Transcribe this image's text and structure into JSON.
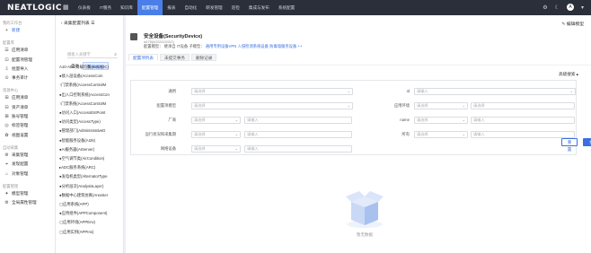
{
  "topbar": {
    "logo": "NEATLOGIC",
    "nav": [
      "仪表板",
      "IT服务",
      "知识库",
      "配置管理",
      "报表",
      "自动化",
      "研发管理",
      "巡检",
      "集成与发布",
      "系统配置"
    ],
    "active": "配置管理"
  },
  "sidebar": {
    "new_label": "新建",
    "groups": [
      {
        "title": "我的工作台",
        "items": [
          {
            "icon": "+",
            "label": "新建",
            "new": true
          }
        ]
      },
      {
        "title": "配置库",
        "items": [
          {
            "icon": "☰",
            "label": "应用清单"
          },
          {
            "icon": "⊡",
            "label": "配置项管理"
          },
          {
            "icon": "⇩",
            "label": "批量导入"
          },
          {
            "icon": "⊙",
            "label": "事务审计"
          }
        ]
      },
      {
        "title": "资源中心",
        "items": [
          {
            "icon": "⊞",
            "label": "应用清单"
          },
          {
            "icon": "⊟",
            "label": "资产清单"
          },
          {
            "icon": "⊠",
            "label": "账号管理"
          },
          {
            "icon": "◎",
            "label": "标签管理"
          },
          {
            "icon": "✿",
            "label": "视图设置"
          }
        ]
      },
      {
        "title": "自动采集",
        "items": [
          {
            "icon": "⚙",
            "label": "采集管理"
          },
          {
            "icon": "⌖",
            "label": "发现配置"
          },
          {
            "icon": "⌂",
            "label": "对象管理"
          }
        ]
      },
      {
        "title": "配置管理",
        "items": [
          {
            "icon": "✦",
            "label": "模型管理"
          },
          {
            "icon": "⚙",
            "label": "全局属性管理"
          }
        ]
      }
    ]
  },
  "tree": {
    "breadcrumb": "采集配置列表",
    "search_placeholder": "模板入关键字",
    "tabs": [
      "自动",
      "目录视图"
    ],
    "active_tab": "目录视图",
    "nodes": [
      "A10-ADC负载均衡(A10ADC)",
      "●接入层设备(AccessCom",
      "↑门禁系统(AccessControlM",
      "●出入口控制系统(AccessCon",
      "↑门禁系统(AccessControlM",
      "●访问入口(AccessEntPoint",
      "●访问类型(AccessType)",
      "●管理部门(AdministrativeD",
      "●智能服务设备(AI26)",
      "●AI服务器(AIServer)",
      "●空气调节类(AirCondition)",
      "▸ADC服务系统(ARC)",
      "●发电机类型(AlternatorType",
      "●分析层次(AnalysisLayer)",
      "●数据中心建筑仿真(AreaSer",
      "▢应用系统(APP)",
      "●应用组件(APPComponent)",
      "▢应用环境(APPEnv)",
      "▢应用实例(APPIns)"
    ]
  },
  "header": {
    "title": "安全设备(SecurityDevice)",
    "id": "#475(6/2/2/2/2/2/2)",
    "meta_prefix": "配置模型：",
    "meta_mid": "继承自 IT设备",
    "meta_child": "子模型：",
    "meta_links": "通用专用设备VPN 入侵检测系统设备 防毒墙服务设备 ++",
    "edit": "编辑模型",
    "tabs": [
      "配置项列表",
      "未提交事务",
      "删除记录"
    ],
    "active_tab": "配置项列表"
  },
  "form": {
    "adv_search": "高级搜索 ▴",
    "fields": [
      {
        "label": "通用",
        "ph": "请选择"
      },
      {
        "label": "id",
        "ph": "请输入"
      },
      {
        "label": "配置项模型",
        "ph": "请选择"
      },
      {
        "label": "应用环境",
        "ph": "请选择",
        "ph2": "请选择"
      },
      {
        "label": "厂商",
        "ph": "请选择",
        "ph2": "请输入"
      },
      {
        "label": "name",
        "ph": "请选择",
        "ph2": "请输入"
      },
      {
        "label": "运行状况和采集期",
        "ph": "请选择",
        "ph2": "请输入"
      },
      {
        "label": "所有",
        "ph": "请选择",
        "ph2": "请输入"
      },
      {
        "label": "网络设备",
        "ph": "请选择",
        "ph2": "请输入"
      }
    ],
    "reset": "重置",
    "search": "搜索"
  },
  "empty": {
    "text": "暂无数据"
  },
  "colors": {
    "topbar": "#2b2f3a",
    "accent": "#3a6fe0"
  }
}
